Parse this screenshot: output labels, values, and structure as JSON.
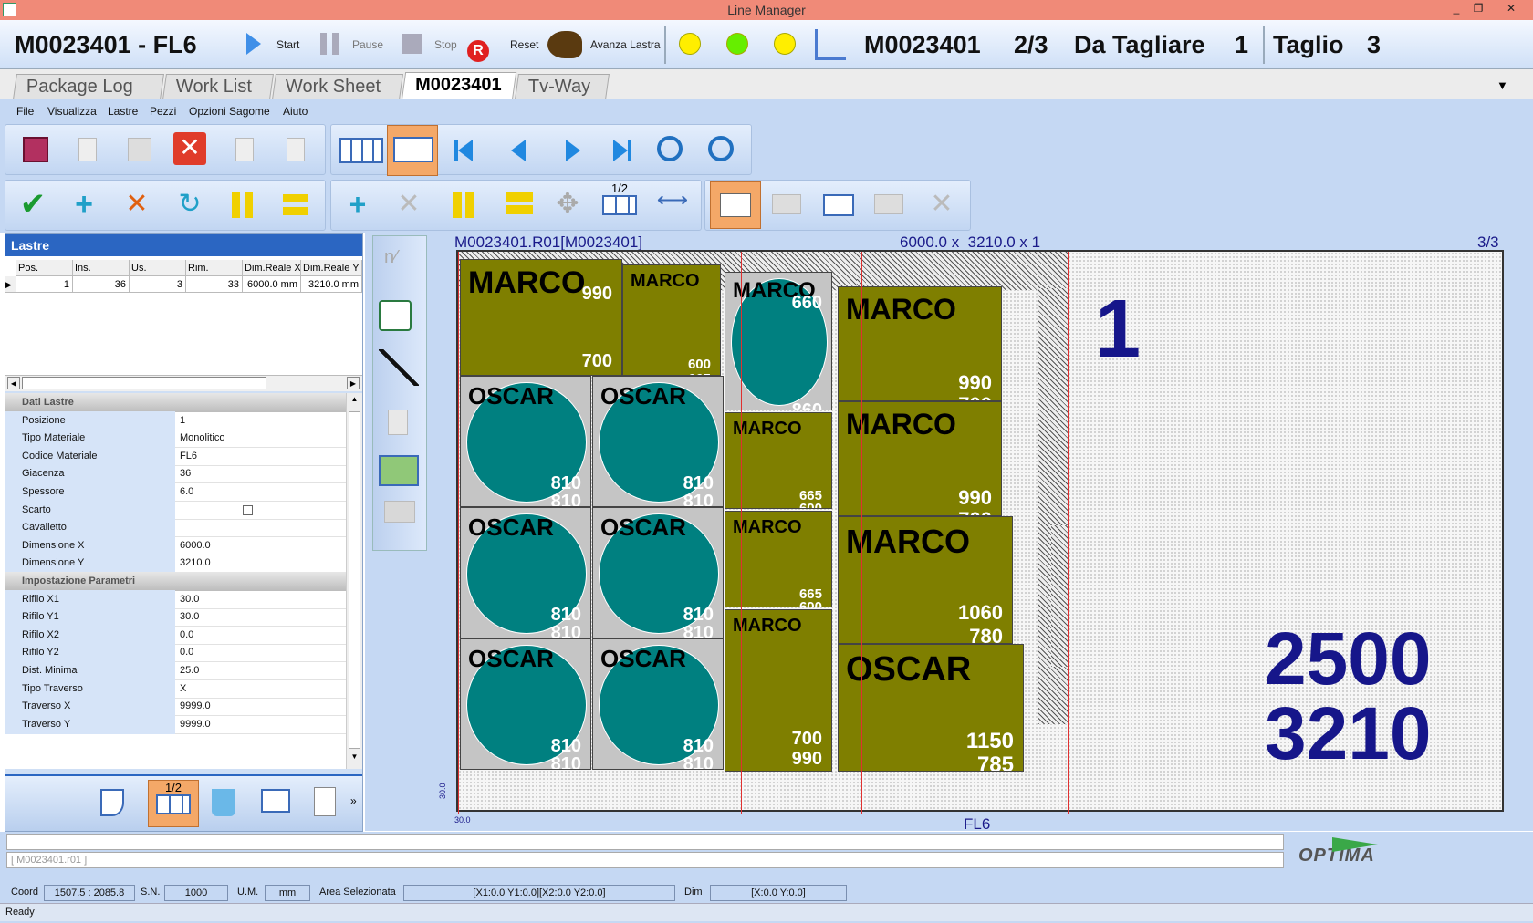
{
  "window": {
    "title": "Line Manager",
    "min": "_",
    "restore": "❐",
    "close": "✕"
  },
  "topbar": {
    "job": "M0023401 - FL6",
    "start": "Start",
    "pause": "Pause",
    "stop": "Stop",
    "reset": "Reset",
    "avanza": "Avanza Lastra",
    "status_job": "M0023401",
    "status_frac": "2/3",
    "status_label": "Da Tagliare",
    "status_count": "1",
    "taglio_label": "Taglio",
    "taglio_val": "3",
    "dots": [
      "#ffee00",
      "#66ee00",
      "#ffee00"
    ]
  },
  "tabs": [
    "Package Log",
    "Work List",
    "Work Sheet",
    "M0023401",
    "Tv-Way"
  ],
  "tab_dropdown": "▼",
  "menu": [
    "File",
    "Visualizza",
    "Lastre",
    "Pezzi",
    "Opzioni Sagome",
    "Aiuto"
  ],
  "toolbar": {
    "half_label": "1/2"
  },
  "lastre": {
    "title": "Lastre",
    "columns": [
      "Pos.",
      "Ins.",
      "Us.",
      "Rim.",
      "Dim.Reale X",
      "Dim.Reale Y"
    ],
    "row": [
      "1",
      "36",
      "3",
      "33",
      "6000.0 mm",
      "3210.0 mm"
    ]
  },
  "props": [
    {
      "cat": "Dati Lastre"
    },
    {
      "k": "Posizione",
      "v": "1"
    },
    {
      "k": "Tipo Materiale",
      "v": "Monolitico"
    },
    {
      "k": "Codice Materiale",
      "v": "FL6"
    },
    {
      "k": "Giacenza",
      "v": "36"
    },
    {
      "k": "Spessore",
      "v": "6.0"
    },
    {
      "k": "Scarto",
      "v": ""
    },
    {
      "k": "Cavalletto",
      "v": ""
    },
    {
      "k": "Dimensione X",
      "v": "6000.0"
    },
    {
      "k": "Dimensione Y",
      "v": "3210.0"
    },
    {
      "cat": "Impostazione Parametri"
    },
    {
      "k": "Rifilo X1",
      "v": "30.0"
    },
    {
      "k": "Rifilo Y1",
      "v": "30.0"
    },
    {
      "k": "Rifilo X2",
      "v": "0.0"
    },
    {
      "k": "Rifilo Y2",
      "v": "0.0"
    },
    {
      "k": "Dist. Minima",
      "v": "25.0"
    },
    {
      "k": "Tipo Traverso",
      "v": "X"
    },
    {
      "k": "Traverso X",
      "v": "9999.0"
    },
    {
      "k": "Traverso Y",
      "v": "9999.0"
    }
  ],
  "sheet": {
    "header_left": "M0023401.R01[M0023401]",
    "header_mid": "6000.0 x  3210.0 x 1",
    "header_right": "3/3",
    "bottom_label": "FL6",
    "origin_x": "30.0",
    "origin_y": "30.0",
    "rest_number": "1",
    "rest_w": "2500",
    "rest_h": "3210"
  },
  "pieces": [
    {
      "name": "MARCO",
      "dims": [
        "990",
        "700"
      ]
    },
    {
      "name": "MARCO",
      "dims": [
        "600",
        "665"
      ]
    },
    {
      "name": "MARCO",
      "dims": [
        "660",
        "860"
      ]
    },
    {
      "name": "MARCO",
      "dims": [
        "990",
        "700"
      ]
    },
    {
      "name": "MARCO",
      "dims": [
        "990",
        "700"
      ]
    },
    {
      "name": "MARCO",
      "dims": [
        "665",
        "600"
      ]
    },
    {
      "name": "MARCO",
      "dims": [
        "665",
        "600"
      ]
    },
    {
      "name": "MARCO",
      "dims": [
        "1060",
        "780"
      ]
    },
    {
      "name": "MARCO",
      "dims": [
        "700",
        "990"
      ]
    },
    {
      "name": "OSCAR",
      "dims": [
        "1150",
        "785"
      ]
    },
    {
      "name": "OSCAR",
      "dims": [
        "810",
        "810"
      ]
    },
    {
      "name": "OSCAR",
      "dims": [
        "810",
        "810"
      ]
    },
    {
      "name": "OSCAR",
      "dims": [
        "810",
        "810"
      ]
    },
    {
      "name": "OSCAR",
      "dims": [
        "810",
        "810"
      ]
    },
    {
      "name": "OSCAR",
      "dims": [
        "810",
        "810"
      ]
    },
    {
      "name": "OSCAR",
      "dims": [
        "810",
        "810"
      ]
    }
  ],
  "footer": {
    "input_hint": "[ M0023401.r01 ]",
    "logo": "OPTIMA",
    "coord_label": "Coord",
    "coord_val": "1507.5 : 2085.8",
    "sn_label": "S.N.",
    "sn_val": "1000",
    "um_label": "U.M.",
    "um_val": "mm",
    "area_label": "Area Selezionata",
    "area_val": "[X1:0.0 Y1:0.0][X2:0.0 Y2:0.0]",
    "dim_label": "Dim",
    "dim_val": "[X:0.0 Y:0.0]",
    "ready": "Ready"
  }
}
